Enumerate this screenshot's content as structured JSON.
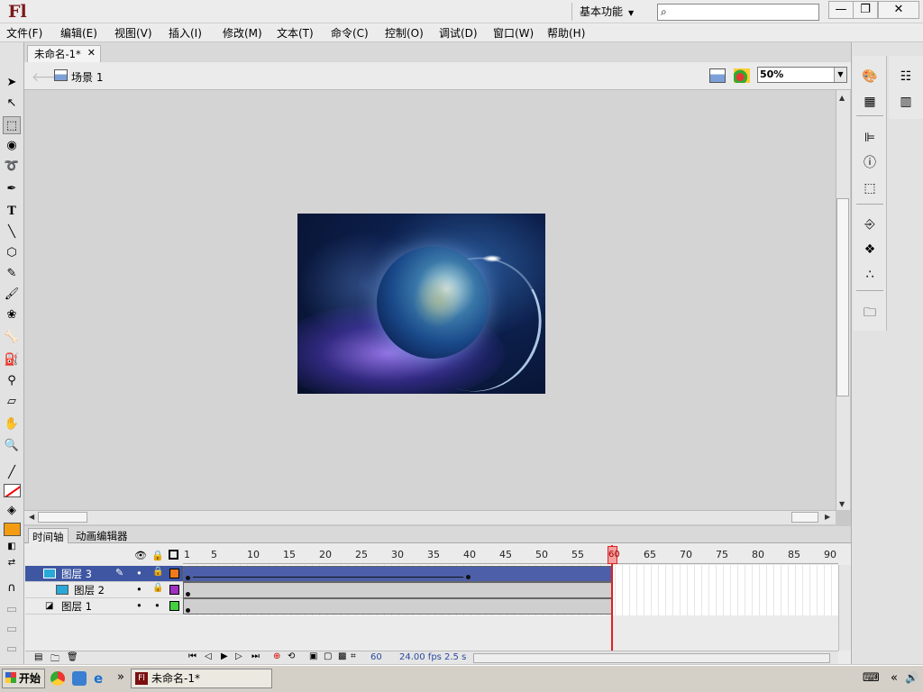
{
  "app": {
    "logo": "Fl",
    "workspace": "基本功能",
    "search_placeholder": ""
  },
  "window_buttons": {
    "minimize": "—",
    "restore": "❐",
    "close": "✕"
  },
  "menu": [
    "文件(F)",
    "编辑(E)",
    "视图(V)",
    "插入(I)",
    "修改(M)",
    "文本(T)",
    "命令(C)",
    "控制(O)",
    "调试(D)",
    "窗口(W)",
    "帮助(H)"
  ],
  "document": {
    "tab_title": "未命名-1*",
    "scene": "场景 1",
    "zoom": "50%"
  },
  "timeline": {
    "tabs": [
      "时间轴",
      "动画编辑器"
    ],
    "ruler": [
      "1",
      "5",
      "10",
      "15",
      "20",
      "25",
      "30",
      "35",
      "40",
      "45",
      "50",
      "55",
      "60",
      "65",
      "70",
      "75",
      "80",
      "85",
      "90"
    ],
    "layers": [
      {
        "name": "图层 3",
        "color": "#f07a1a"
      },
      {
        "name": "图层 2",
        "color": "#a030c0"
      },
      {
        "name": "图层 1",
        "color": "#40d040"
      }
    ],
    "current_frame": "60",
    "fps": "24.00 fps",
    "elapsed": "2.5 s",
    "playhead_label": "60"
  },
  "colors": {
    "stroke": "#ff0000",
    "fill": "#f39c12"
  },
  "taskbar": {
    "start": "开始",
    "item": "未命名-1*",
    "more": "»"
  }
}
